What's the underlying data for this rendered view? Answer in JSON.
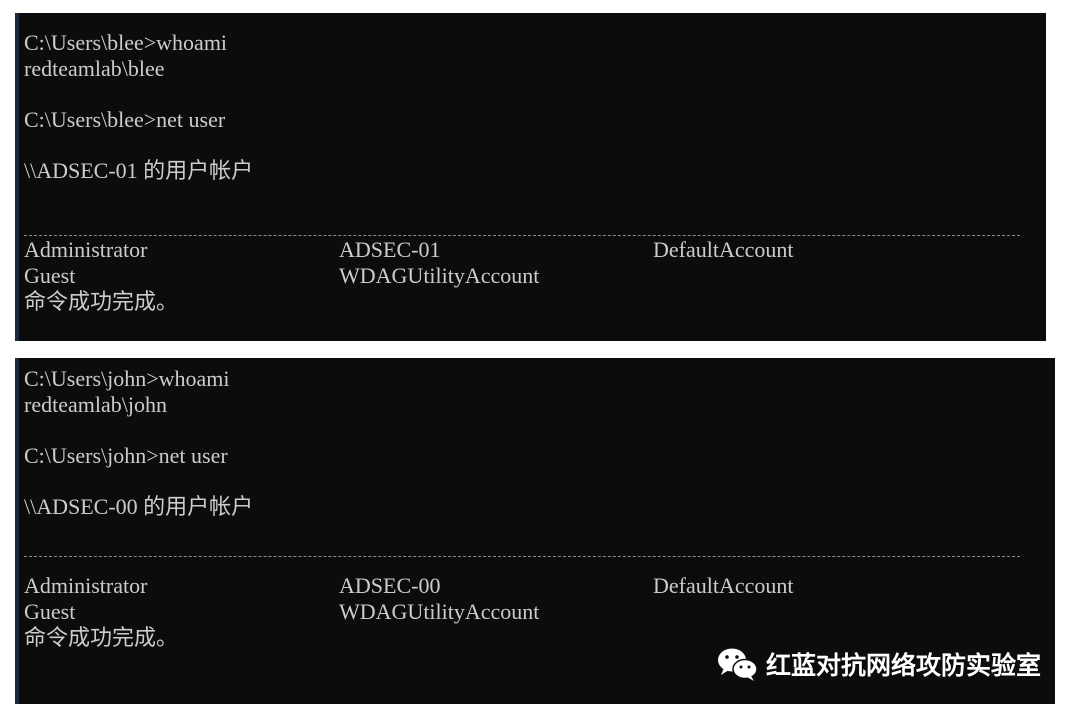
{
  "terminals": [
    {
      "lines": [
        "C:\\Users\\blee>whoami",
        "redteamlab\\blee",
        "C:\\Users\\blee>net user",
        "\\\\ADSEC-01 的用户帐户"
      ],
      "separator": "-----------------------------------------------------------------------------",
      "users": {
        "col1": [
          "Administrator",
          "Guest"
        ],
        "col2": [
          "ADSEC-01",
          "WDAGUtilityAccount"
        ],
        "col3": [
          "DefaultAccount"
        ]
      },
      "status": "命令成功完成。"
    },
    {
      "lines": [
        "C:\\Users\\john>whoami",
        "redteamlab\\john",
        "C:\\Users\\john>net user",
        "\\\\ADSEC-00 的用户帐户"
      ],
      "separator": "-----------------------------------------------------------------------------",
      "users": {
        "col1": [
          "Administrator",
          "Guest"
        ],
        "col2": [
          "ADSEC-00",
          "WDAGUtilityAccount"
        ],
        "col3": [
          "DefaultAccount"
        ]
      },
      "status": "命令成功完成。"
    }
  ],
  "watermark": {
    "text": "红蓝对抗网络攻防实验室",
    "icon": "wechat-icon"
  },
  "colors": {
    "terminal_bg": "#0c0c0c",
    "terminal_text": "#cccccc",
    "watermark_text": "#ffffff"
  }
}
